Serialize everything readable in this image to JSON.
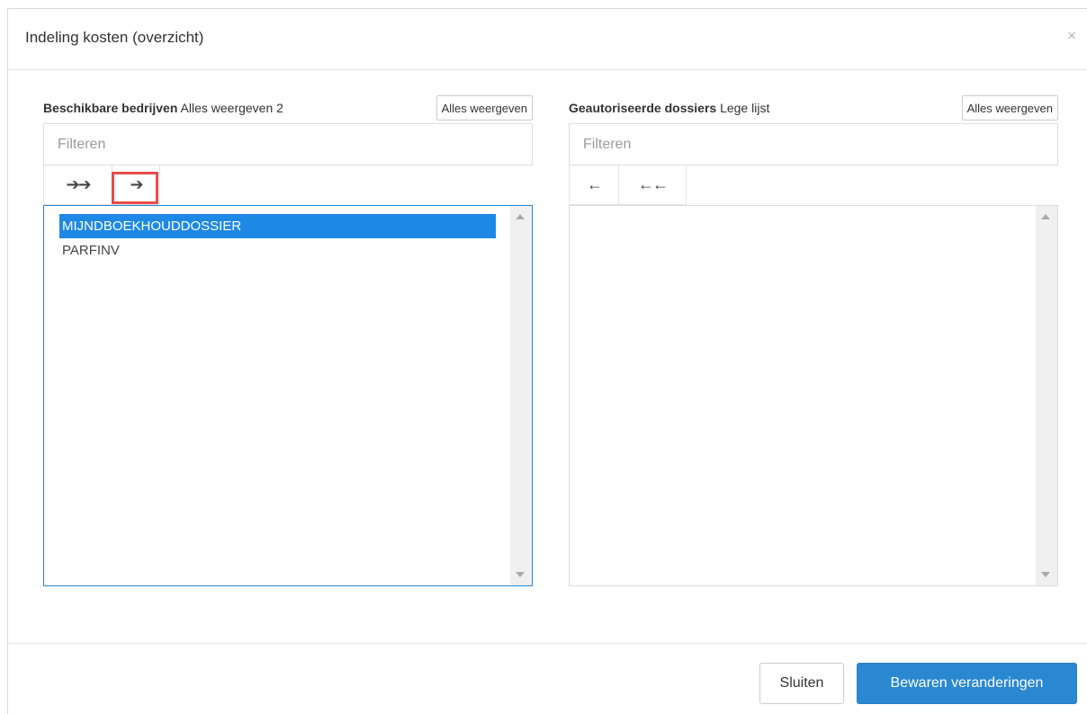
{
  "modal": {
    "title": "Indeling kosten (overzicht)",
    "close_glyph": "×"
  },
  "left": {
    "heading": "Beschikbare bedrijven",
    "info": "Alles weergeven 2",
    "show_all_label": "Alles weergeven",
    "filter_placeholder": "Filteren",
    "move_all_glyph": "➔➔",
    "move_selected_glyph": "➔",
    "items": [
      {
        "label": "MIJNDBOEKHOUDDOSSIER",
        "selected": true
      },
      {
        "label": "PARFINV",
        "selected": false
      }
    ]
  },
  "right": {
    "heading": "Geautoriseerde dossiers",
    "info": "Lege lijst",
    "show_all_label": "Alles weergeven",
    "filter_placeholder": "Filteren",
    "remove_selected_glyph": "←",
    "remove_all_glyph": "←←",
    "items": []
  },
  "footer": {
    "close_label": "Sluiten",
    "save_label": "Bewaren veranderingen"
  },
  "colors": {
    "accent": "#2a88d0",
    "selection": "#1e88e5",
    "highlight": "#e74c4c"
  }
}
